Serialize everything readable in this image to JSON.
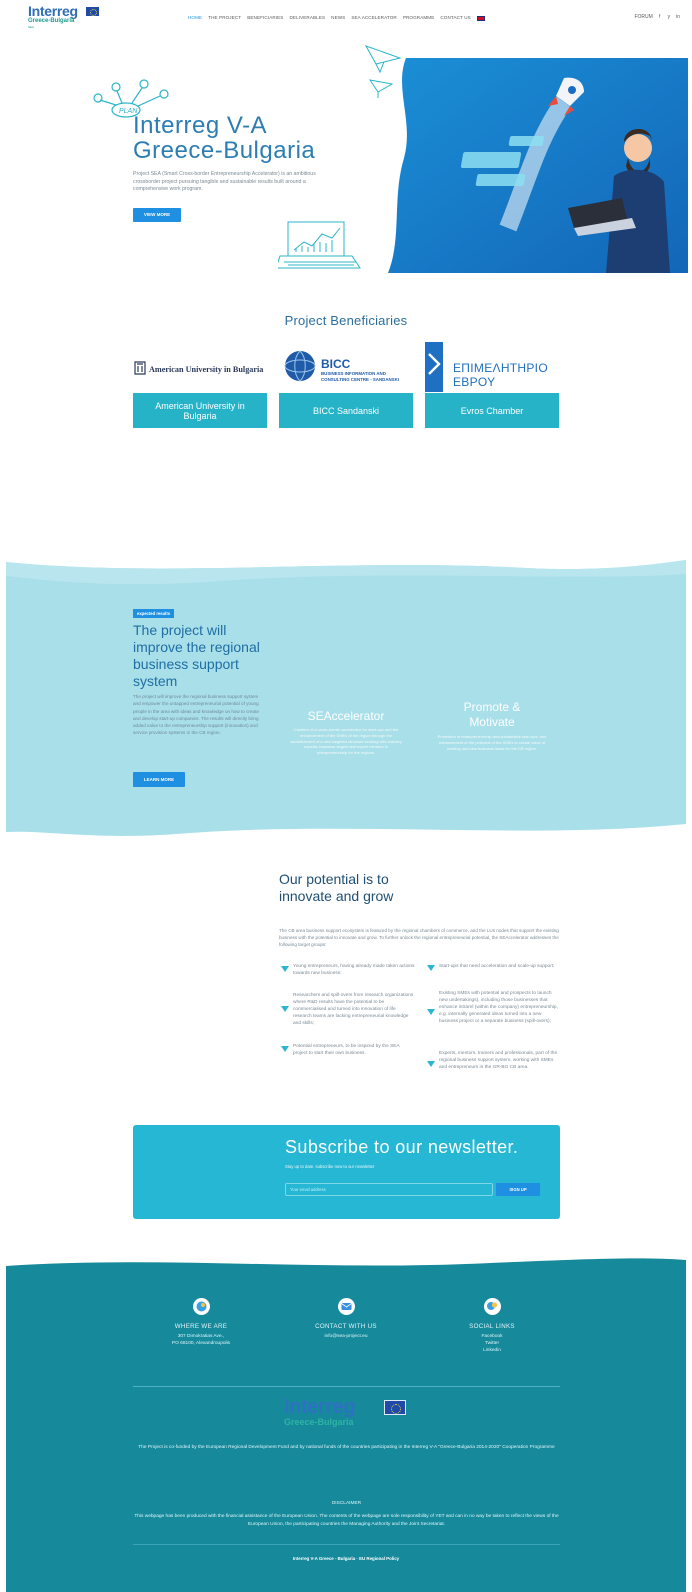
{
  "header": {
    "logo": {
      "word": "Interreg",
      "sub": "Greece-Bulgaria",
      "tag": "SEA",
      "tagline": "Smart Cross-border Entrepreneurship Accelerator"
    },
    "nav": [
      "HOME",
      "THE PROJECT",
      "BENEFICIARIES",
      "DELIVERABLES",
      "NEWS",
      "SEA ACCELERATOR",
      "PROGRAMME",
      "CONTACT US"
    ],
    "active_nav": "HOME",
    "forum": "FORUM",
    "social": [
      "f",
      " y",
      "in"
    ]
  },
  "hero": {
    "title_line1": "Interreg V-A",
    "title_line2": "Greece-Bulgaria",
    "description": "Project SEA (Smart Cross-border Entrepreneurship Accelerator) is an ambitious crossborder project pursuing tangible and sustainable results built around a comprehensive work program.",
    "button": "VIEW MORE",
    "plan_label": "PLAN"
  },
  "beneficiaries": {
    "title": "Project Beneficiaries",
    "items": [
      {
        "logo_text": "American University in Bulgaria",
        "label": "American University in Bulgaria"
      },
      {
        "logo_text": "BICC",
        "logo_sub": "BUSINESS INFORMATION AND CONSULTING CENTRE - SANDANSKI",
        "label": "BICC Sandanski"
      },
      {
        "logo_text": "ΕΠΙΜΕΛΗΤΗΡΙΟ",
        "logo_sub": "ΕΒΡΟΥ",
        "label": "Evros Chamber"
      }
    ]
  },
  "expected": {
    "badge": "expected results",
    "title": "The project will improve the regional business support system",
    "description": "The project will improve the regional business support system and empower the untapped entrepreneurial potential of young people in the area with ideas and knowledge on how to create and develop start-up companies. The results will directly bring added value to the entrepreneurship support (innovation) and service provision systems in the CB region.",
    "button": "LEARN MORE",
    "features": [
      {
        "title": "SEAccelerator",
        "desc": "Creation of a cross-border accelerator for start-ups and the enhancement of the SMEs of the region through the establishment of a new targeted structure working with industry experts, business angels and expert mentors in entrepreneurship for the regions."
      },
      {
        "title": "Promote & Motivate",
        "desc": "Promotion of entrepreneurship and sustainable start-ups, and enhancement of the potential of the SMEs to create value of existing and new business ideas for the CB region."
      }
    ]
  },
  "potential": {
    "title": "Our potential is to innovate and grow",
    "description": "The CB area business support ecosystem is featured by the regional chambers of commerce, and the LUs nodes that support the existing business with the potential to innovate and grow. To further unlock the regional entrepreneurial potential, the SEAccelerator addresses the following target groups:",
    "left": [
      "Young entrepreneurs, having already made taken actions towards new business;",
      "Researchers and spill-overs from research organizations where R&D results have the potential to be commercialised and turned into innovation of life research teams are lacking entrepreneurial knowledge and skills;",
      "Potential entrepreneurs, to be inspired by the SEA project to start their own business."
    ],
    "right": [
      "Start-ups that need acceleration and scale-up support;",
      "Existing SMEs with potential and prospects to launch new undertakings), including those businesses that enhance intrarel (within the company) entrepreneurship, e.g. internally generated ideas turned into a new business project or a separate business (spill-overs);",
      "Experts, mentors, trainers and professionals, part of the regional business support system, working with SMEs and entrepreneurs in the GR-BG CB area."
    ]
  },
  "newsletter": {
    "title": "Subscribe to our newsletter.",
    "subtitle": "Stay up to date. subscribe now to our newsletter",
    "placeholder": "Your email address",
    "button": "SIGN UP"
  },
  "footer": {
    "where": {
      "head": "WHERE WE ARE",
      "lines": [
        "307 Dimokratias Ave.,",
        "PO 68100, Alexandroupolis"
      ]
    },
    "contact": {
      "head": "CONTACT WITH US",
      "lines": [
        "info@sea-project.eu"
      ]
    },
    "social": {
      "head": "SOCIAL LINKS",
      "lines": [
        "Facebook",
        "Twitter",
        "Linkedin"
      ]
    },
    "logo_word": "Interreg",
    "logo_sub": "Greece-Bulgaria",
    "funding": "The Project is co-funded by the European Regional Development Fund and by national funds of the countries participating in the Interreg V-A \"Greece-Bulgaria 2014-2020\" Cooperation Programme",
    "disclaimer_head": "DISCLAIMER",
    "disclaimer": "This webpage has been produced with the financial assistance of the European Union. The contents of the webpage are sole responsibility of YET and can in no way be taken to reflect the views of the European Union, the participating countries the Managing Authority and the Joint Secretariat.",
    "copyright": "Interreg V-A Greece - Bulgaria · EU Regional Policy"
  },
  "colors": {
    "accent_blue": "#1e8fe1",
    "teal": "#26b3c8",
    "wave_light": "#a9dfe9",
    "footer_teal": "#16899b"
  }
}
